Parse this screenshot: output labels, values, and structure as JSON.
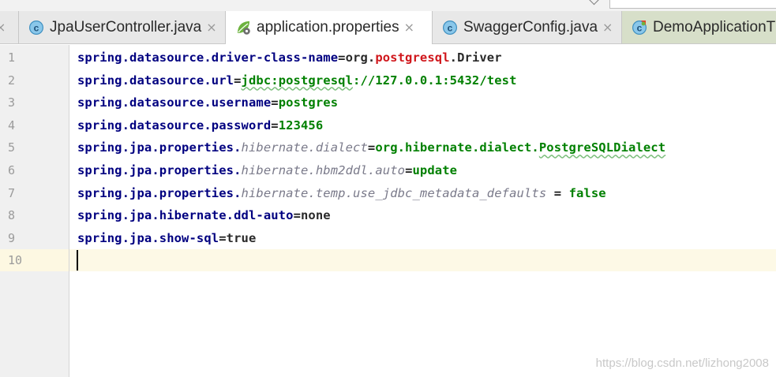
{
  "tabs": [
    {
      "label": "",
      "icon": "close-icon",
      "active": false
    },
    {
      "label": "JpaUserController.java",
      "icon": "java-class-icon",
      "active": false
    },
    {
      "label": "application.properties",
      "icon": "spring-properties-icon",
      "active": true
    },
    {
      "label": "SwaggerConfig.java",
      "icon": "java-class-icon",
      "active": false
    },
    {
      "label": "DemoApplicationT",
      "icon": "spring-boot-class-icon",
      "active": false
    }
  ],
  "close_glyph": "×",
  "lines": [
    {
      "num": "1",
      "parts": [
        {
          "t": "spring",
          "c": "k"
        },
        {
          "t": ".",
          "c": "k"
        },
        {
          "t": "datasource",
          "c": "k"
        },
        {
          "t": ".",
          "c": "k"
        },
        {
          "t": "driver-class-name",
          "c": "k"
        },
        {
          "t": "=",
          "c": "eq"
        },
        {
          "t": "org",
          "c": "vp"
        },
        {
          "t": ".",
          "c": "vp"
        },
        {
          "t": "postgresql",
          "c": "vr"
        },
        {
          "t": ".",
          "c": "vp"
        },
        {
          "t": "Driver",
          "c": "vp"
        }
      ]
    },
    {
      "num": "2",
      "parts": [
        {
          "t": "spring",
          "c": "k"
        },
        {
          "t": ".",
          "c": "k"
        },
        {
          "t": "datasource",
          "c": "k"
        },
        {
          "t": ".",
          "c": "k"
        },
        {
          "t": "url",
          "c": "k"
        },
        {
          "t": "=",
          "c": "eq"
        },
        {
          "t": "jdbc:postgresql",
          "c": "v sq"
        },
        {
          "t": "://127.0.0.1:5432/test",
          "c": "v"
        }
      ]
    },
    {
      "num": "3",
      "parts": [
        {
          "t": "spring",
          "c": "k"
        },
        {
          "t": ".",
          "c": "k"
        },
        {
          "t": "datasource",
          "c": "k"
        },
        {
          "t": ".",
          "c": "k"
        },
        {
          "t": "username",
          "c": "k"
        },
        {
          "t": "=",
          "c": "eq"
        },
        {
          "t": "postgres",
          "c": "v"
        }
      ]
    },
    {
      "num": "4",
      "parts": [
        {
          "t": "spring",
          "c": "k"
        },
        {
          "t": ".",
          "c": "k"
        },
        {
          "t": "datasource",
          "c": "k"
        },
        {
          "t": ".",
          "c": "k"
        },
        {
          "t": "password",
          "c": "k"
        },
        {
          "t": "=",
          "c": "eq"
        },
        {
          "t": "123456",
          "c": "v"
        }
      ]
    },
    {
      "num": "5",
      "parts": [
        {
          "t": "spring",
          "c": "k"
        },
        {
          "t": ".",
          "c": "k"
        },
        {
          "t": "jpa",
          "c": "k"
        },
        {
          "t": ".",
          "c": "k"
        },
        {
          "t": "properties",
          "c": "k"
        },
        {
          "t": ".",
          "c": "k"
        },
        {
          "t": "hibernate",
          "c": "vi"
        },
        {
          "t": ".",
          "c": "vi"
        },
        {
          "t": "dialect",
          "c": "vi"
        },
        {
          "t": "=",
          "c": "eq"
        },
        {
          "t": "org.hibernate.dialect.",
          "c": "v"
        },
        {
          "t": "PostgreSQLDialect",
          "c": "v sq"
        }
      ]
    },
    {
      "num": "6",
      "parts": [
        {
          "t": "spring",
          "c": "k"
        },
        {
          "t": ".",
          "c": "k"
        },
        {
          "t": "jpa",
          "c": "k"
        },
        {
          "t": ".",
          "c": "k"
        },
        {
          "t": "properties",
          "c": "k"
        },
        {
          "t": ".",
          "c": "k"
        },
        {
          "t": "hibernate",
          "c": "vi"
        },
        {
          "t": ".",
          "c": "vi"
        },
        {
          "t": "hbm2ddl",
          "c": "vi"
        },
        {
          "t": ".",
          "c": "vi"
        },
        {
          "t": "auto",
          "c": "vi"
        },
        {
          "t": "=",
          "c": "eq"
        },
        {
          "t": "update",
          "c": "v"
        }
      ]
    },
    {
      "num": "7",
      "parts": [
        {
          "t": "spring",
          "c": "k"
        },
        {
          "t": ".",
          "c": "k"
        },
        {
          "t": "jpa",
          "c": "k"
        },
        {
          "t": ".",
          "c": "k"
        },
        {
          "t": "properties",
          "c": "k"
        },
        {
          "t": ".",
          "c": "k"
        },
        {
          "t": "hibernate",
          "c": "vi"
        },
        {
          "t": ".",
          "c": "vi"
        },
        {
          "t": "temp",
          "c": "vi"
        },
        {
          "t": ".",
          "c": "vi"
        },
        {
          "t": "use_jdbc_metadata_defaults",
          "c": "vi"
        },
        {
          "t": " = ",
          "c": "eq"
        },
        {
          "t": "false",
          "c": "v"
        }
      ]
    },
    {
      "num": "8",
      "parts": [
        {
          "t": "spring",
          "c": "k"
        },
        {
          "t": ".",
          "c": "k"
        },
        {
          "t": "jpa",
          "c": "k"
        },
        {
          "t": ".",
          "c": "k"
        },
        {
          "t": "hibernate",
          "c": "k"
        },
        {
          "t": ".",
          "c": "k"
        },
        {
          "t": "ddl-auto",
          "c": "k"
        },
        {
          "t": "=",
          "c": "eq"
        },
        {
          "t": "none",
          "c": "vp"
        }
      ]
    },
    {
      "num": "9",
      "parts": [
        {
          "t": "spring",
          "c": "k"
        },
        {
          "t": ".",
          "c": "k"
        },
        {
          "t": "jpa",
          "c": "k"
        },
        {
          "t": ".",
          "c": "k"
        },
        {
          "t": "show-sql",
          "c": "k"
        },
        {
          "t": "=",
          "c": "eq"
        },
        {
          "t": "true",
          "c": "vp"
        }
      ]
    },
    {
      "num": "10",
      "parts": []
    }
  ],
  "current_line": "10",
  "watermark": "https://blog.csdn.net/lizhong2008",
  "colors": {
    "key": "#000080",
    "value": "#008000",
    "keyword": "#d0161b",
    "italic": "#7a7a8a",
    "current_line": "#fdf9e6"
  }
}
